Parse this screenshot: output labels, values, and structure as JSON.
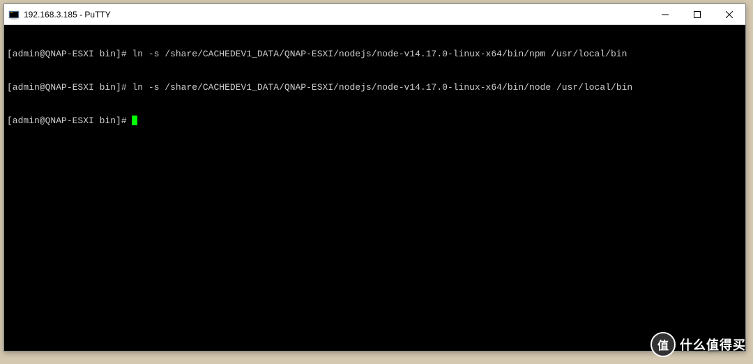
{
  "window": {
    "title": "192.168.3.185 - PuTTY"
  },
  "terminal": {
    "lines": [
      {
        "prompt": "[admin@QNAP-ESXI bin]#",
        "command": "ln -s /share/CACHEDEV1_DATA/QNAP-ESXI/nodejs/node-v14.17.0-linux-x64/bin/npm /usr/local/bin"
      },
      {
        "prompt": "[admin@QNAP-ESXI bin]#",
        "command": "ln -s /share/CACHEDEV1_DATA/QNAP-ESXI/nodejs/node-v14.17.0-linux-x64/bin/node /usr/local/bin"
      },
      {
        "prompt": "[admin@QNAP-ESXI bin]#",
        "command": ""
      }
    ]
  },
  "watermark": {
    "badge": "值",
    "text": "什么值得买"
  }
}
